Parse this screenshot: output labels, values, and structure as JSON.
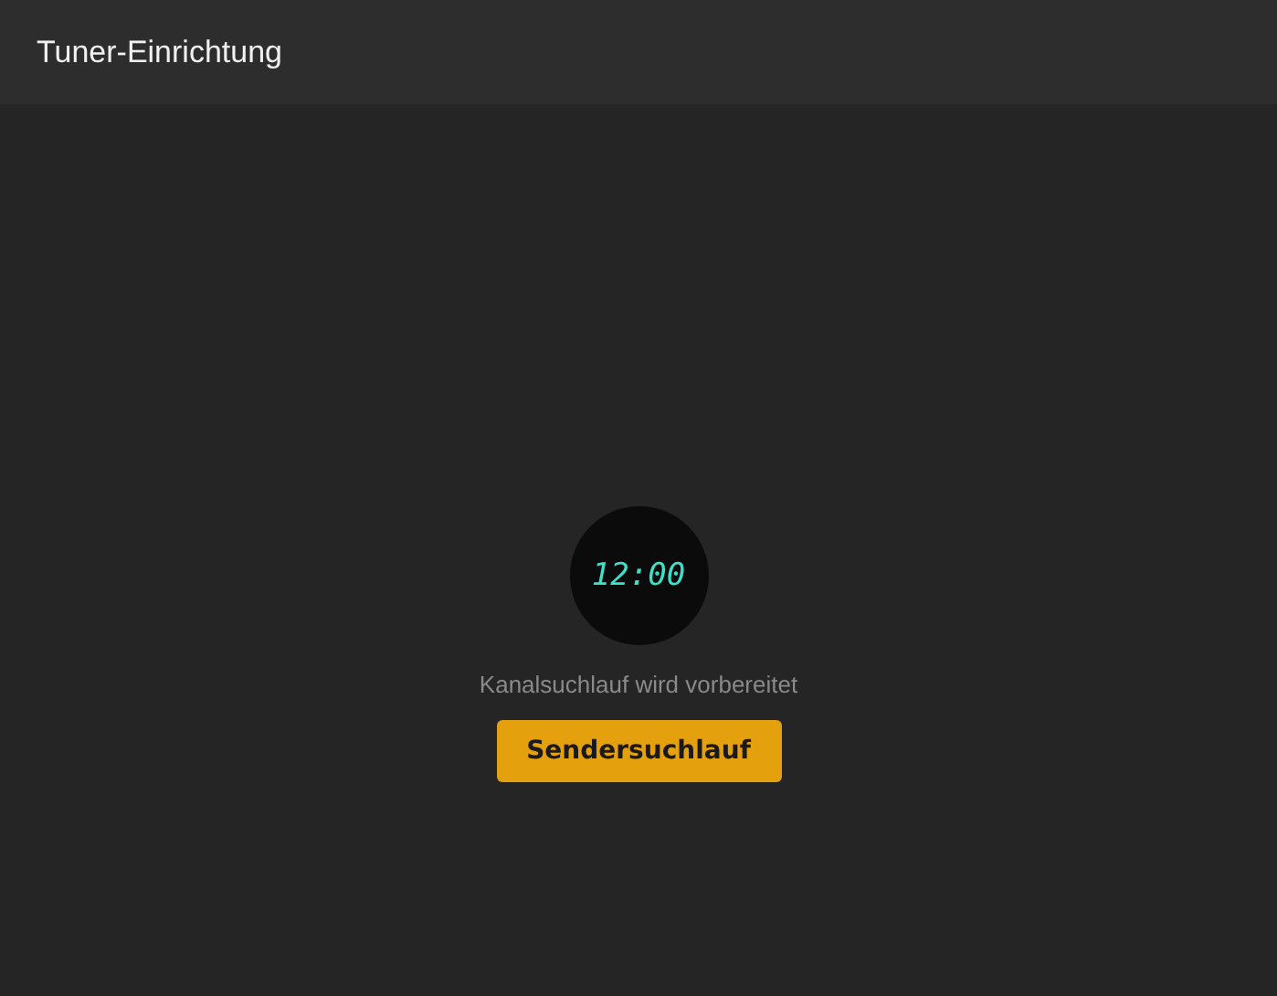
{
  "window": {
    "title": "Tuner-Einrichtung"
  },
  "clock": {
    "time": "12:00"
  },
  "status": "Kanalsuchlauf wird vorbereitet",
  "buttons": [
    "Sendersuchlauf"
  ]
}
